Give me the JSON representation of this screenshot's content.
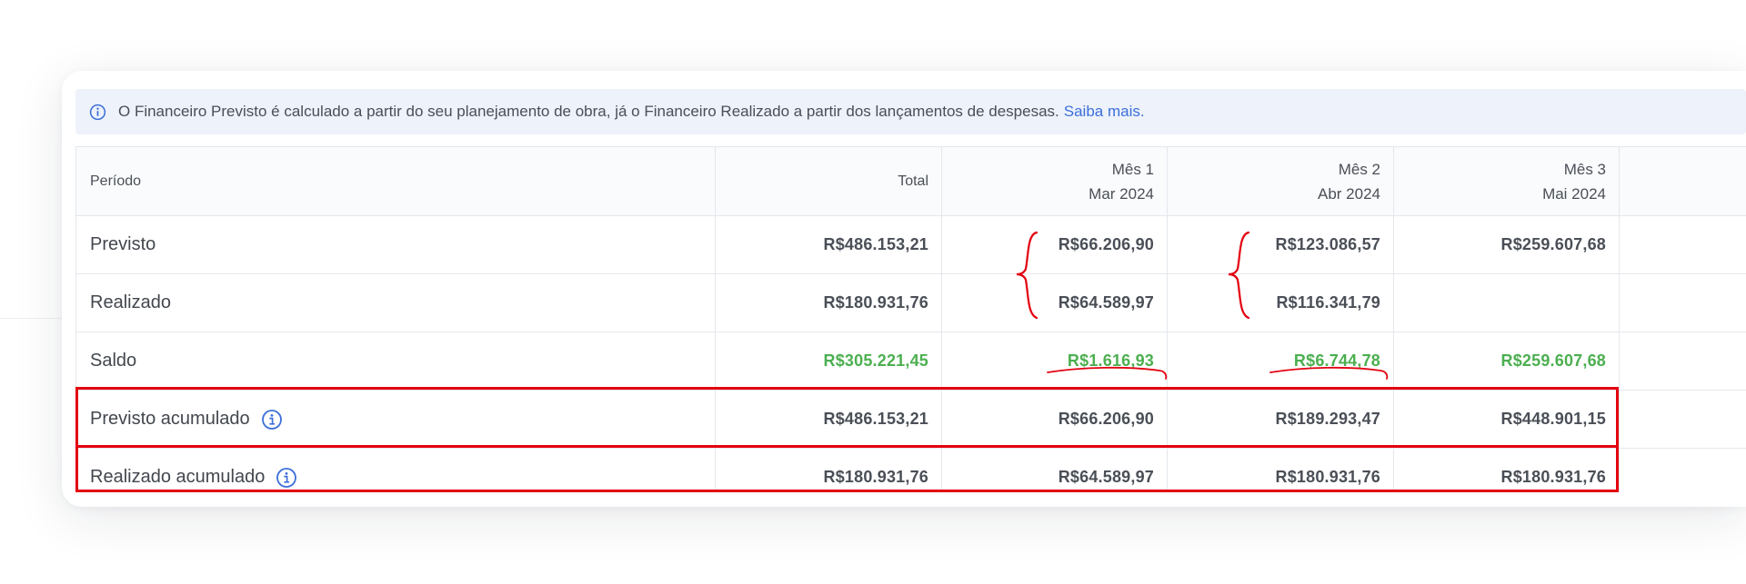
{
  "notice": {
    "text": "O Financeiro Previsto é calculado a partir do seu planejamento de obra, já o Financeiro Realizado a partir dos lançamentos de despesas.",
    "link": "Saiba mais."
  },
  "table": {
    "header": {
      "period": "Período",
      "total": "Total",
      "months": [
        {
          "label": "Mês 1",
          "date": "Mar 2024"
        },
        {
          "label": "Mês 2",
          "date": "Abr 2024"
        },
        {
          "label": "Mês 3",
          "date": "Mai 2024"
        }
      ]
    },
    "rows": [
      {
        "label": "Previsto",
        "total": "R$486.153,21",
        "m1": "R$66.206,90",
        "m2": "R$123.086,57",
        "m3": "R$259.607,68"
      },
      {
        "label": "Realizado",
        "total": "R$180.931,76",
        "m1": "R$64.589,97",
        "m2": "R$116.341,79",
        "m3": ""
      },
      {
        "label": "Saldo",
        "total": "R$305.221,45",
        "m1": "R$1.616,93",
        "m2": "R$6.744,78",
        "m3": "R$259.607,68"
      },
      {
        "label": "Previsto acumulado",
        "total": "R$486.153,21",
        "m1": "R$66.206,90",
        "m2": "R$189.293,47",
        "m3": "R$448.901,15"
      },
      {
        "label": "Realizado acumulado",
        "total": "R$180.931,76",
        "m1": "R$64.589,97",
        "m2": "R$180.931,76",
        "m3": "R$180.931,76"
      }
    ]
  },
  "colors": {
    "positive": "#4caf50",
    "link": "#3c6fd9",
    "notice_bg": "#edf2fb",
    "annotation": "#e3000f"
  },
  "icons": [
    "info-icon"
  ]
}
